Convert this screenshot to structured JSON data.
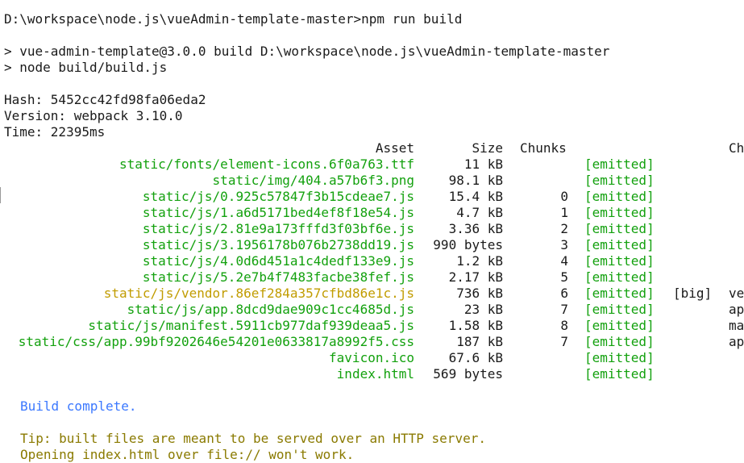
{
  "command_line": "D:\\workspace\\node.js\\vueAdmin-template-master>npm run build",
  "npm_output": [
    "> vue-admin-template@3.0.0 build D:\\workspace\\node.js\\vueAdmin-template-master",
    "> node build/build.js"
  ],
  "hash_line": "Hash: 5452cc42fd98fa06eda2",
  "version_line": "Version: webpack 3.10.0",
  "time_line": "Time: 22395ms",
  "table_headers": {
    "asset": "Asset",
    "size": "Size",
    "chunks": "Chunks",
    "chunk_names": "Ch"
  },
  "assets": [
    {
      "name": "static/fonts/element-icons.6f0a763.ttf",
      "size": "11 kB",
      "chunk": "",
      "status": "[emitted]",
      "flag": "",
      "chunk_name": "",
      "highlight": false
    },
    {
      "name": "static/img/404.a57b6f3.png",
      "size": "98.1 kB",
      "chunk": "",
      "status": "[emitted]",
      "flag": "",
      "chunk_name": "",
      "highlight": false
    },
    {
      "name": "static/js/0.925c57847f3b15cdeae7.js",
      "size": "15.4 kB",
      "chunk": "0",
      "status": "[emitted]",
      "flag": "",
      "chunk_name": "",
      "highlight": false
    },
    {
      "name": "static/js/1.a6d5171bed4ef8f18e54.js",
      "size": "4.7 kB",
      "chunk": "1",
      "status": "[emitted]",
      "flag": "",
      "chunk_name": "",
      "highlight": false
    },
    {
      "name": "static/js/2.81e9a173fffd3f03bf6e.js",
      "size": "3.36 kB",
      "chunk": "2",
      "status": "[emitted]",
      "flag": "",
      "chunk_name": "",
      "highlight": false
    },
    {
      "name": "static/js/3.1956178b076b2738dd19.js",
      "size": "990 bytes",
      "chunk": "3",
      "status": "[emitted]",
      "flag": "",
      "chunk_name": "",
      "highlight": false
    },
    {
      "name": "static/js/4.0d6d451a1c4dedf133e9.js",
      "size": "1.2 kB",
      "chunk": "4",
      "status": "[emitted]",
      "flag": "",
      "chunk_name": "",
      "highlight": false
    },
    {
      "name": "static/js/5.2e7b4f7483facbe38fef.js",
      "size": "2.17 kB",
      "chunk": "5",
      "status": "[emitted]",
      "flag": "",
      "chunk_name": "",
      "highlight": false
    },
    {
      "name": "static/js/vendor.86ef284a357cfbd86e1c.js",
      "size": "736 kB",
      "chunk": "6",
      "status": "[emitted]",
      "flag": "[big]",
      "chunk_name": "ve",
      "highlight": true
    },
    {
      "name": "static/js/app.8dcd9dae909c1cc4685d.js",
      "size": "23 kB",
      "chunk": "7",
      "status": "[emitted]",
      "flag": "",
      "chunk_name": "ap",
      "highlight": false
    },
    {
      "name": "static/js/manifest.5911cb977daf939deaa5.js",
      "size": "1.58 kB",
      "chunk": "8",
      "status": "[emitted]",
      "flag": "",
      "chunk_name": "ma",
      "highlight": false
    },
    {
      "name": "static/css/app.99bf9202646e54201e0633817a8992f5.css",
      "size": "187 kB",
      "chunk": "7",
      "status": "[emitted]",
      "flag": "",
      "chunk_name": "ap",
      "highlight": false
    },
    {
      "name": "favicon.ico",
      "size": "67.6 kB",
      "chunk": "",
      "status": "[emitted]",
      "flag": "",
      "chunk_name": "",
      "highlight": false
    },
    {
      "name": "index.html",
      "size": "569 bytes",
      "chunk": "",
      "status": "[emitted]",
      "flag": "",
      "chunk_name": "",
      "highlight": false
    }
  ],
  "build_complete": "Build complete.",
  "tip_lines": [
    "Tip: built files are meant to be served over an HTTP server.",
    "Opening index.html over file:// won't work."
  ],
  "colors": {
    "asset_name": "#13a10e",
    "highlight_name": "#c19c00",
    "emitted": "#13a10e",
    "build_complete": "#3b78ff",
    "tip": "#8a7a00"
  }
}
